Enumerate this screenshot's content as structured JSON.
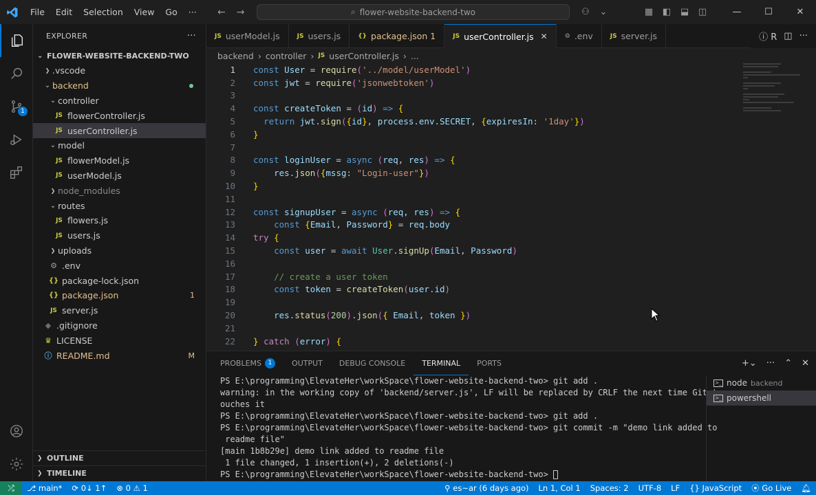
{
  "titlebar": {
    "menu": [
      "File",
      "Edit",
      "Selection",
      "View",
      "Go",
      "···"
    ],
    "search": "flower-website-backend-two"
  },
  "sidebar": {
    "title": "EXPLORER",
    "more": "···",
    "root": "FLOWER-WEBSITE-BACKEND-TWO",
    "tree": [
      {
        "label": ".vscode",
        "type": "folder",
        "open": false,
        "depth": 1
      },
      {
        "label": "backend",
        "type": "folder",
        "open": true,
        "depth": 1,
        "status": "modified-dot"
      },
      {
        "label": "controller",
        "type": "folder",
        "open": true,
        "depth": 2
      },
      {
        "label": "flowerController.js",
        "type": "js",
        "depth": 3
      },
      {
        "label": "userController.js",
        "type": "js",
        "depth": 3,
        "selected": true
      },
      {
        "label": "model",
        "type": "folder",
        "open": true,
        "depth": 2
      },
      {
        "label": "flowerModel.js",
        "type": "js",
        "depth": 3
      },
      {
        "label": "userModel.js",
        "type": "js",
        "depth": 3
      },
      {
        "label": "node_modules",
        "type": "folder",
        "open": false,
        "depth": 2,
        "dim": true
      },
      {
        "label": "routes",
        "type": "folder",
        "open": true,
        "depth": 2
      },
      {
        "label": "flowers.js",
        "type": "js",
        "depth": 3
      },
      {
        "label": "users.js",
        "type": "js",
        "depth": 3
      },
      {
        "label": "uploads",
        "type": "folder",
        "open": false,
        "depth": 2
      },
      {
        "label": ".env",
        "type": "env",
        "depth": 2
      },
      {
        "label": "package-lock.json",
        "type": "json",
        "depth": 2
      },
      {
        "label": "package.json",
        "type": "json",
        "depth": 2,
        "modified": true,
        "decoration": "1"
      },
      {
        "label": "server.js",
        "type": "js",
        "depth": 2
      },
      {
        "label": ".gitignore",
        "type": "git",
        "depth": 1
      },
      {
        "label": "LICENSE",
        "type": "lic",
        "depth": 1
      },
      {
        "label": "README.md",
        "type": "info",
        "depth": 1,
        "decoration": "M"
      }
    ],
    "outline": "OUTLINE",
    "timeline": "TIMELINE"
  },
  "tabs": [
    {
      "label": "userModel.js",
      "icon": "JS"
    },
    {
      "label": "users.js",
      "icon": "JS"
    },
    {
      "label": "package.json 1",
      "icon": "{}",
      "modified": true
    },
    {
      "label": "userController.js",
      "icon": "JS",
      "active": true
    },
    {
      "label": ".env",
      "icon": "⚙"
    },
    {
      "label": "server.js",
      "icon": "JS"
    }
  ],
  "breadcrumb": [
    "backend",
    "controller",
    "userController.js",
    "..."
  ],
  "code": [
    {
      "n": "1",
      "t": "const User = require('../model/userModel')"
    },
    {
      "n": "2",
      "t": "const jwt = require('jsonwebtoken')"
    },
    {
      "n": "3",
      "t": ""
    },
    {
      "n": "4",
      "t": "const createToken = (id) => {"
    },
    {
      "n": "5",
      "t": "  return jwt.sign({id}, process.env.SECRET, {expiresIn: '1day'})"
    },
    {
      "n": "6",
      "t": "}"
    },
    {
      "n": "7",
      "t": ""
    },
    {
      "n": "8",
      "t": "const loginUser = async (req, res) => {"
    },
    {
      "n": "9",
      "t": "    res.json({mssg: \"Login-user\"})"
    },
    {
      "n": "10",
      "t": "}"
    },
    {
      "n": "11",
      "t": ""
    },
    {
      "n": "12",
      "t": "const signupUser = async (req, res) => {"
    },
    {
      "n": "13",
      "t": "    const {Email, Password} = req.body"
    },
    {
      "n": "14",
      "t": "try {"
    },
    {
      "n": "15",
      "t": "    const user = await User.signUp(Email, Password)"
    },
    {
      "n": "16",
      "t": ""
    },
    {
      "n": "17",
      "t": "    // create a user token"
    },
    {
      "n": "18",
      "t": "    const token = createToken(user.id)"
    },
    {
      "n": "19",
      "t": ""
    },
    {
      "n": "20",
      "t": "    res.status(200).json({ Email, token })"
    },
    {
      "n": "21",
      "t": ""
    },
    {
      "n": "22",
      "t": "} catch (error) {"
    }
  ],
  "panel": {
    "tabs": [
      {
        "label": "PROBLEMS",
        "badge": "1"
      },
      {
        "label": "OUTPUT"
      },
      {
        "label": "DEBUG CONSOLE"
      },
      {
        "label": "TERMINAL",
        "active": true
      },
      {
        "label": "PORTS"
      }
    ],
    "terminal_lines": [
      "PS E:\\programming\\ElevateHer\\workSpace\\flower-website-backend-two> git add .",
      "warning: in the working copy of 'backend/server.js', LF will be replaced by CRLF the next time Git t",
      "ouches it",
      "PS E:\\programming\\ElevateHer\\workSpace\\flower-website-backend-two> git add .",
      "PS E:\\programming\\ElevateHer\\workSpace\\flower-website-backend-two> git commit -m \"demo link added to",
      " readme file\"",
      "[main 1b8b29e] demo link added to readme file",
      " 1 file changed, 1 insertion(+), 2 deletions(-)",
      "PS E:\\programming\\ElevateHer\\workSpace\\flower-website-backend-two> "
    ],
    "terminals": [
      {
        "name": "node",
        "sub": "backend"
      },
      {
        "name": "powershell",
        "sub": "",
        "selected": true
      }
    ]
  },
  "status": {
    "branch": "main*",
    "sync": "0↓ 1↑",
    "errors": "0",
    "warnings": "1",
    "git_blame": "es~ar (6 days ago)",
    "position": "Ln 1, Col 1",
    "spaces": "Spaces: 2",
    "encoding": "UTF-8",
    "eol": "LF",
    "language": "JavaScript",
    "golive": "Go Live"
  },
  "colors": {
    "accent": "#0078d4",
    "statusbar": "#0078d4",
    "remote": "#16825d",
    "modified": "#e2c08d"
  }
}
